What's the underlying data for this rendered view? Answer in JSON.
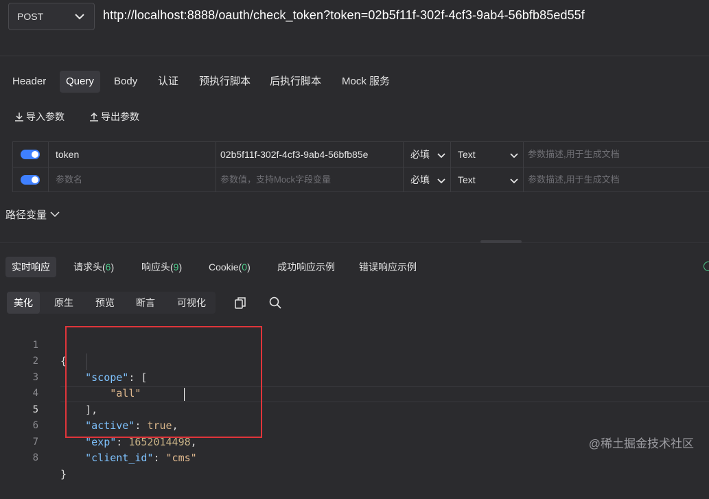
{
  "url_bar": {
    "method": "POST",
    "url": "http://localhost:8888/oauth/check_token?token=02b5f11f-302f-4cf3-9ab4-56bfb85ed55f"
  },
  "request_tabs": [
    "Header",
    "Query",
    "Body",
    "认证",
    "预执行脚本",
    "后执行脚本",
    "Mock 服务"
  ],
  "request_tabs_active": "Query",
  "param_actions": {
    "import": "导入参数",
    "export": "导出参数"
  },
  "params": [
    {
      "enabled": true,
      "name": "token",
      "value": "02b5f11f-302f-4cf3-9ab4-56bfb85e",
      "required": "必填",
      "type": "Text",
      "description_placeholder": "参数描述,用于生成文档"
    },
    {
      "enabled": true,
      "name_placeholder": "参数名",
      "value_placeholder": "参数值，支持Mock字段变量",
      "required": "必填",
      "type": "Text",
      "description_placeholder": "参数描述,用于生成文档"
    }
  ],
  "path_variables_label": "路径变量",
  "response_tabs": {
    "realtime": "实时响应",
    "req_headers": "请求头",
    "req_headers_count": "6",
    "res_headers": "响应头",
    "res_headers_count": "9",
    "cookie": "Cookie",
    "cookie_count": "0",
    "success_example": "成功响应示例",
    "error_example": "错误响应示例"
  },
  "view_tabs": [
    "美化",
    "原生",
    "预览",
    "断言",
    "可视化"
  ],
  "view_tabs_active": "美化",
  "response_body": {
    "line_numbers": [
      "1",
      "2",
      "3",
      "4",
      "5",
      "6",
      "7",
      "8"
    ],
    "current_line": "5",
    "l1": "{",
    "scope_key": "\"scope\"",
    "scope_item": "\"all\"",
    "l4": "],",
    "active_key": "\"active\"",
    "active_val": "true",
    "exp_key": "\"exp\"",
    "exp_val": "1652014498",
    "client_id_key": "\"client_id\"",
    "client_id_val": "\"cms\"",
    "l8": "}"
  },
  "watermark": "@稀土掘金技术社区",
  "colors": {
    "accent": "#3f80ff",
    "count": "#4ec98a",
    "highlight_box": "#e0353a",
    "json_key": "#7fc3ff"
  }
}
